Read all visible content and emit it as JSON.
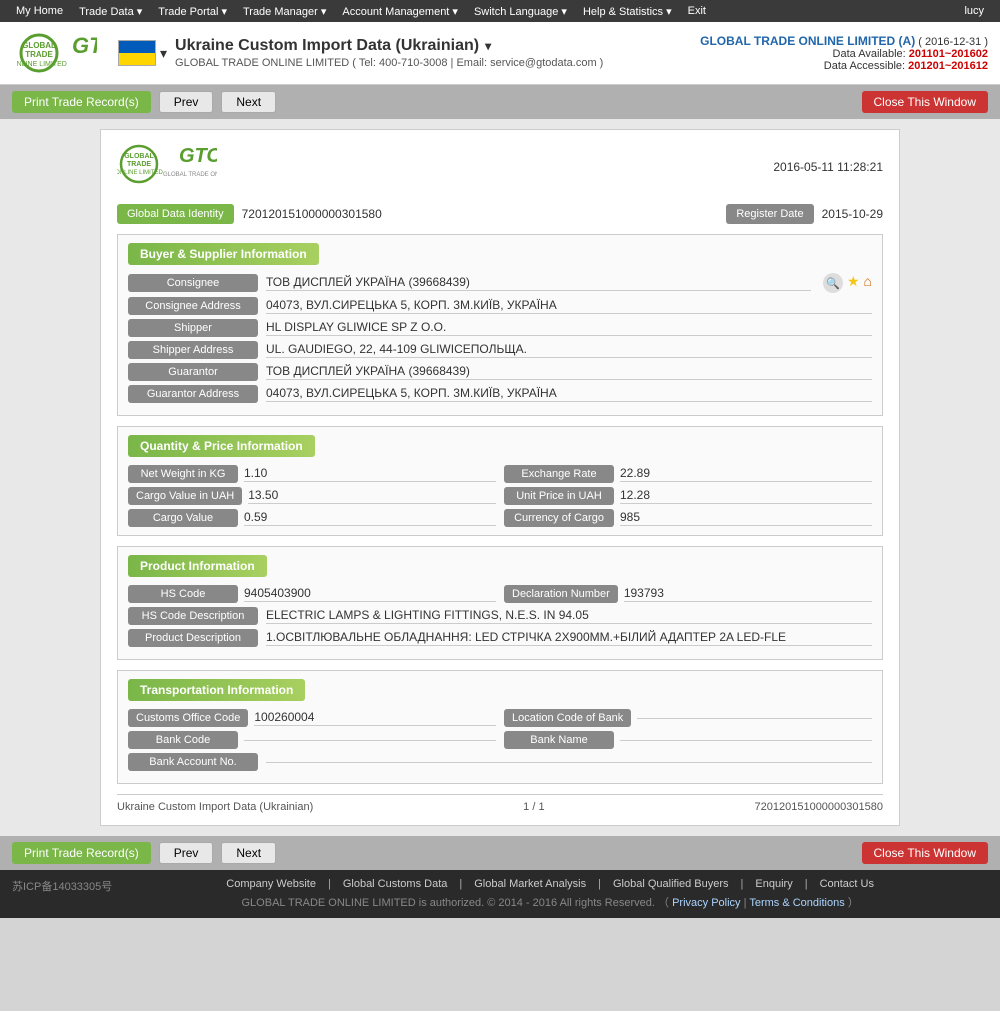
{
  "topnav": {
    "items": [
      "My Home",
      "Trade Data",
      "Trade Portal",
      "Trade Manager",
      "Account Management",
      "Switch Language",
      "Help & Statistics",
      "Exit"
    ],
    "user": "lucy"
  },
  "header": {
    "title": "Ukraine Custom Import Data (Ukrainian)",
    "company_full": "GLOBAL TRADE ONLINE LIMITED ( Tel: 400-710-3008 | Email: service@gtodata.com )",
    "account_company": "GLOBAL TRADE ONLINE LIMITED (A)",
    "date_bracket": "( 2016-12-31 )",
    "data_available_label": "Data Available:",
    "data_available_value": "201101~201602",
    "data_accessible_label": "Data Accessible:",
    "data_accessible_value": "201201~201612"
  },
  "toolbar": {
    "print_label": "Print Trade Record(s)",
    "prev_label": "Prev",
    "next_label": "Next",
    "close_label": "Close This Window"
  },
  "record": {
    "date": "2016-05-11 11:28:21",
    "global_data_identity_label": "Global Data Identity",
    "global_data_identity_value": "720120151000000301580",
    "register_date_label": "Register Date",
    "register_date_value": "2015-10-29",
    "sections": {
      "buyer_supplier": {
        "title": "Buyer & Supplier Information",
        "fields": [
          {
            "label": "Consignee",
            "value": "ТОВ ДИСПЛЕЙ УКРАЇНА (39668439)",
            "has_icons": true
          },
          {
            "label": "Consignee Address",
            "value": "04073, ВУЛ.СИРЕЦЬКА 5, КОРП. 3М.КИЇВ, УКРАЇНА",
            "has_icons": false
          },
          {
            "label": "Shipper",
            "value": "HL DISPLAY GLIWICE SP Z O.O.",
            "has_icons": false
          },
          {
            "label": "Shipper Address",
            "value": "UL. GAUDIEGO, 22, 44-109 GLIWICEПОЛЬЩА.",
            "has_icons": false
          },
          {
            "label": "Guarantor",
            "value": "ТОВ ДИСПЛЕЙ УКРАЇНА  (39668439)",
            "has_icons": false
          },
          {
            "label": "Guarantor Address",
            "value": "04073, ВУЛ.СИРЕЦЬКА 5, КОРП. 3М.КИЇВ, УКРАЇНА",
            "has_icons": false
          }
        ]
      },
      "quantity_price": {
        "title": "Quantity & Price Information",
        "left_fields": [
          {
            "label": "Net Weight in KG",
            "value": "1.10"
          },
          {
            "label": "Cargo Value in UAH",
            "value": "13.50"
          },
          {
            "label": "Cargo Value",
            "value": "0.59"
          }
        ],
        "right_fields": [
          {
            "label": "Exchange Rate",
            "value": "22.89"
          },
          {
            "label": "Unit Price in UAH",
            "value": "12.28"
          },
          {
            "label": "Currency of Cargo",
            "value": "985"
          }
        ]
      },
      "product": {
        "title": "Product Information",
        "fields": [
          {
            "label": "HS Code",
            "value": "9405403900",
            "right_label": "Declaration Number",
            "right_value": "193793"
          },
          {
            "label": "HS Code Description",
            "value": "ELECTRIC LAMPS & LIGHTING FITTINGS, N.E.S. IN 94.05"
          },
          {
            "label": "Product Description",
            "value": "1.ОСВІТЛЮВАЛЬНЕ ОБЛАДНАННЯ: LED СТРІЧКА 2Х900ММ.+БІЛИЙ АДАПТЕР 2A LED-FLE"
          }
        ]
      },
      "transportation": {
        "title": "Transportation Information",
        "fields": [
          {
            "label": "Customs Office Code",
            "value": "100260004",
            "right_label": "Location Code of Bank",
            "right_value": ""
          },
          {
            "label": "Bank Code",
            "value": "",
            "right_label": "Bank Name",
            "right_value": ""
          },
          {
            "label": "Bank Account No.",
            "value": ""
          }
        ]
      }
    },
    "footer": {
      "left": "Ukraine Custom Import Data (Ukrainian)",
      "center": "1 / 1",
      "right": "720120151000000301580"
    }
  },
  "bottom_footer": {
    "icp": "苏ICP备14033305号",
    "links": [
      "Company Website",
      "Global Customs Data",
      "Global Market Analysis",
      "Global Qualified Buyers",
      "Enquiry",
      "Contact Us"
    ],
    "separators": [
      "|",
      "|",
      "|",
      "|",
      "|"
    ],
    "copy": "GLOBAL TRADE ONLINE LIMITED is authorized. © 2014 - 2016 All rights Reserved.  （",
    "privacy": "Privacy Policy",
    "separator2": "|",
    "terms": "Terms & Conditions",
    "copy_end": "）"
  }
}
